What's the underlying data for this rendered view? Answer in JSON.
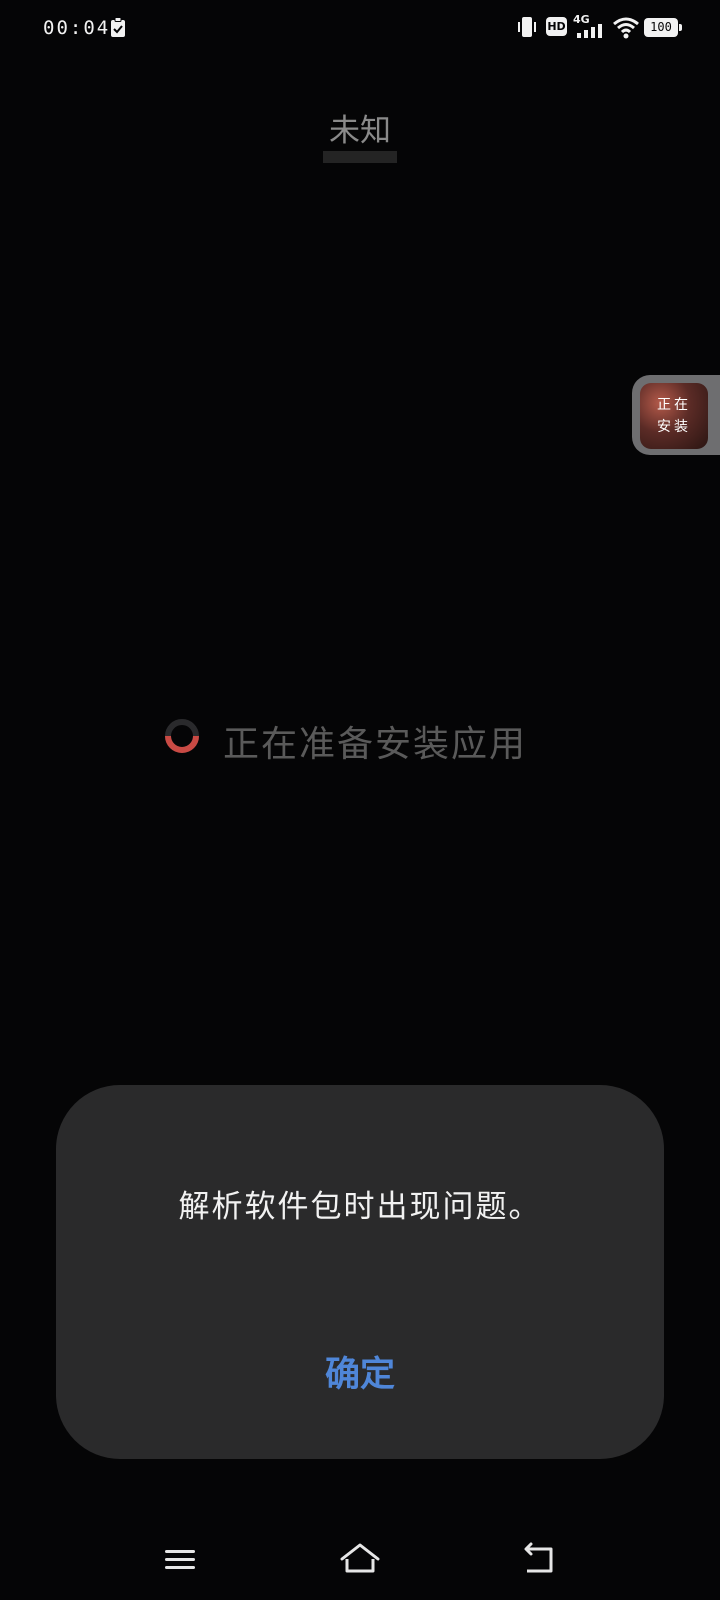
{
  "status_bar": {
    "time": "00:04",
    "network": "4G",
    "hd_badge": "HD",
    "battery": "100",
    "icons": [
      "clipboard-check-icon",
      "vibrate-icon",
      "hd-icon",
      "signal-4g-icon",
      "wifi-icon",
      "battery-icon"
    ]
  },
  "app": {
    "name": "未知"
  },
  "floating_bubble": {
    "text_line1": "正在",
    "text_line2": "安装"
  },
  "progress": {
    "text": "正在准备安装应用",
    "spinner_color": "#c94a44"
  },
  "dialog": {
    "message": "解析软件包时出现问题。",
    "ok_label": "确定",
    "ok_color": "#4f86d8"
  },
  "nav_bar": {
    "icons": [
      "menu-icon",
      "home-icon",
      "back-icon"
    ]
  }
}
